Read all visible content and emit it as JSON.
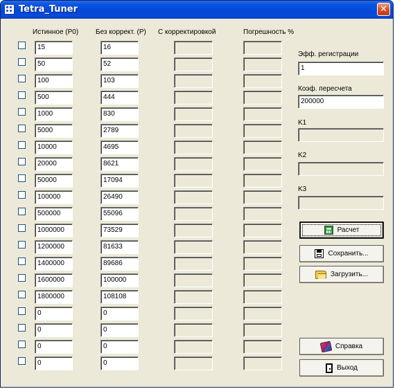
{
  "window": {
    "title": "Tetra_Tuner",
    "close_glyph": "✕"
  },
  "headers": {
    "true": "Истинное (P0)",
    "uncorrected": "Без коррект. (P)",
    "corrected": "С корректировкой",
    "error": "Погрешность %"
  },
  "rows": [
    {
      "checked": false,
      "p0": "15",
      "p": "16",
      "corrected": "",
      "error": ""
    },
    {
      "checked": false,
      "p0": "50",
      "p": "52",
      "corrected": "",
      "error": ""
    },
    {
      "checked": false,
      "p0": "100",
      "p": "103",
      "corrected": "",
      "error": ""
    },
    {
      "checked": false,
      "p0": "500",
      "p": "444",
      "corrected": "",
      "error": ""
    },
    {
      "checked": false,
      "p0": "1000",
      "p": "830",
      "corrected": "",
      "error": ""
    },
    {
      "checked": false,
      "p0": "5000",
      "p": "2789",
      "corrected": "",
      "error": ""
    },
    {
      "checked": false,
      "p0": "10000",
      "p": "4695",
      "corrected": "",
      "error": ""
    },
    {
      "checked": false,
      "p0": "20000",
      "p": "8621",
      "corrected": "",
      "error": ""
    },
    {
      "checked": false,
      "p0": "50000",
      "p": "17094",
      "corrected": "",
      "error": ""
    },
    {
      "checked": false,
      "p0": "100000",
      "p": "26490",
      "corrected": "",
      "error": ""
    },
    {
      "checked": false,
      "p0": "500000",
      "p": "55096",
      "corrected": "",
      "error": ""
    },
    {
      "checked": false,
      "p0": "1000000",
      "p": "73529",
      "corrected": "",
      "error": ""
    },
    {
      "checked": false,
      "p0": "1200000",
      "p": "81633",
      "corrected": "",
      "error": ""
    },
    {
      "checked": false,
      "p0": "1400000",
      "p": "89686",
      "corrected": "",
      "error": ""
    },
    {
      "checked": false,
      "p0": "1600000",
      "p": "100000",
      "corrected": "",
      "error": ""
    },
    {
      "checked": false,
      "p0": "1800000",
      "p": "108108",
      "corrected": "",
      "error": ""
    },
    {
      "checked": false,
      "p0": "0",
      "p": "0",
      "corrected": "",
      "error": ""
    },
    {
      "checked": false,
      "p0": "0",
      "p": "0",
      "corrected": "",
      "error": ""
    },
    {
      "checked": false,
      "p0": "0",
      "p": "0",
      "corrected": "",
      "error": ""
    },
    {
      "checked": false,
      "p0": "0",
      "p": "0",
      "corrected": "",
      "error": ""
    }
  ],
  "side": {
    "eff_reg": {
      "label": "Эфф. регистрации",
      "value": "1"
    },
    "conv_coef": {
      "label": "Коэф. пересчета",
      "value": "200000"
    },
    "k1": {
      "label": "K1",
      "value": ""
    },
    "k2": {
      "label": "K2",
      "value": ""
    },
    "k3": {
      "label": "K3",
      "value": ""
    }
  },
  "buttons": {
    "calc": "Расчет",
    "save": "Сохранить...",
    "load": "Загрузить...",
    "help": "Справка",
    "exit": "Выход"
  },
  "icons": {
    "app": "grid-app-icon",
    "calc": "calculator-icon",
    "save": "floppy-disk-icon",
    "load": "open-folder-icon",
    "help": "help-book-icon",
    "exit": "exit-door-icon"
  }
}
